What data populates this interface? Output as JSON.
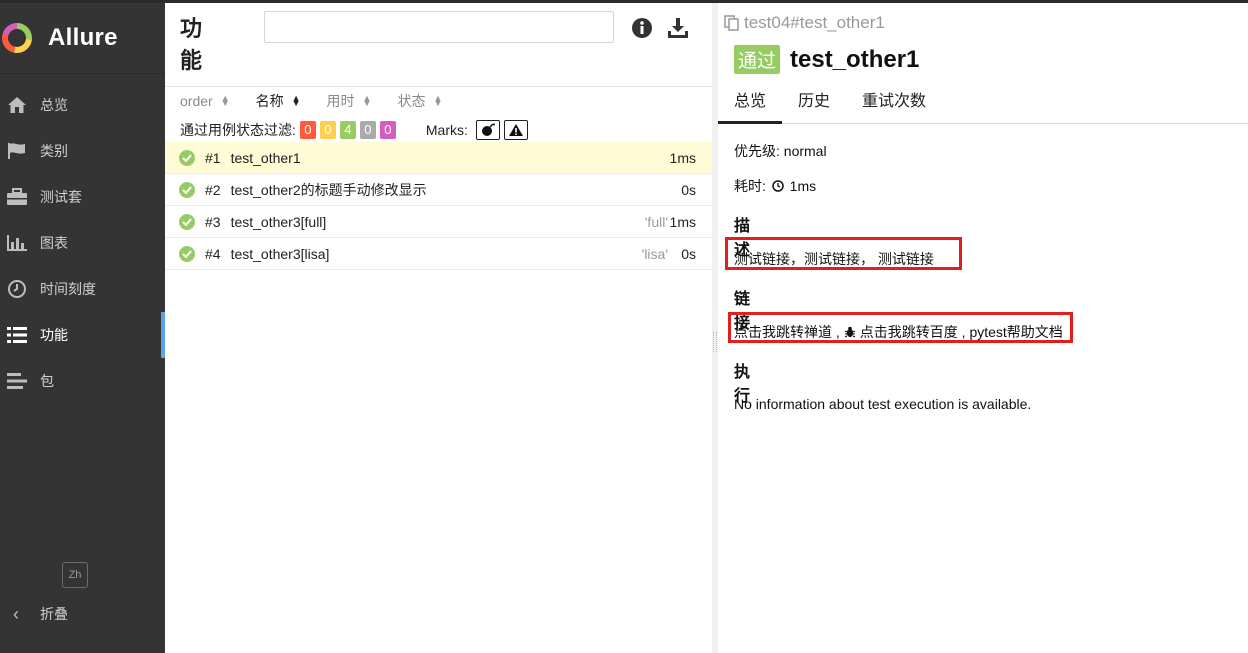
{
  "app": {
    "brand": "Allure",
    "lang_toggle": "Zh",
    "collapse_label": "折叠"
  },
  "sidebar": {
    "items": [
      {
        "label": "总览",
        "icon": "home-icon"
      },
      {
        "label": "类别",
        "icon": "flag-icon"
      },
      {
        "label": "测试套",
        "icon": "briefcase-icon"
      },
      {
        "label": "图表",
        "icon": "bar-chart-icon"
      },
      {
        "label": "时间刻度",
        "icon": "clock-icon"
      },
      {
        "label": "功能",
        "icon": "list-icon",
        "active": true
      },
      {
        "label": "包",
        "icon": "align-left-icon"
      }
    ]
  },
  "middle": {
    "title": "功能",
    "search_value": "",
    "sort": [
      {
        "label": "order"
      },
      {
        "label": "名称"
      },
      {
        "label": "用时"
      },
      {
        "label": "状态"
      }
    ],
    "filter_label": "通过用例状态过滤:",
    "filter_counts": [
      {
        "value": "0",
        "color": "#fd5a3e"
      },
      {
        "value": "0",
        "color": "#ffd050"
      },
      {
        "value": "4",
        "color": "#97cc64"
      },
      {
        "value": "0",
        "color": "#aaaaaa"
      },
      {
        "value": "0",
        "color": "#d35ebe"
      }
    ],
    "marks_label": "Marks:",
    "rows": [
      {
        "num": "#1",
        "name": "test_other1",
        "param": "",
        "duration": "1ms"
      },
      {
        "num": "#2",
        "name": "test_other2的标题手动修改显示",
        "param": "",
        "duration": "0s"
      },
      {
        "num": "#3",
        "name": "test_other3[full]",
        "param": "'full'",
        "duration": "1ms"
      },
      {
        "num": "#4",
        "name": "test_other3[lisa]",
        "param": "'lisa'",
        "duration": "0s"
      }
    ]
  },
  "detail": {
    "breadcrumb": "test04#test_other1",
    "status": "通过",
    "title": "test_other1",
    "tabs": [
      {
        "label": "总览"
      },
      {
        "label": "历史"
      },
      {
        "label": "重试次数"
      }
    ],
    "priority": "优先级: normal",
    "duration_label": "耗时:",
    "duration_value": "1ms",
    "description_heading": "描述",
    "description_text": "测试链接，测试链接， 测试链接",
    "links_heading": "链接",
    "link_1": "点击我跳转禅道 ,",
    "link_2": "点击我跳转百度 , pytest帮助文档",
    "execution_heading": "执行",
    "execution_text": "No information about test execution is available."
  }
}
